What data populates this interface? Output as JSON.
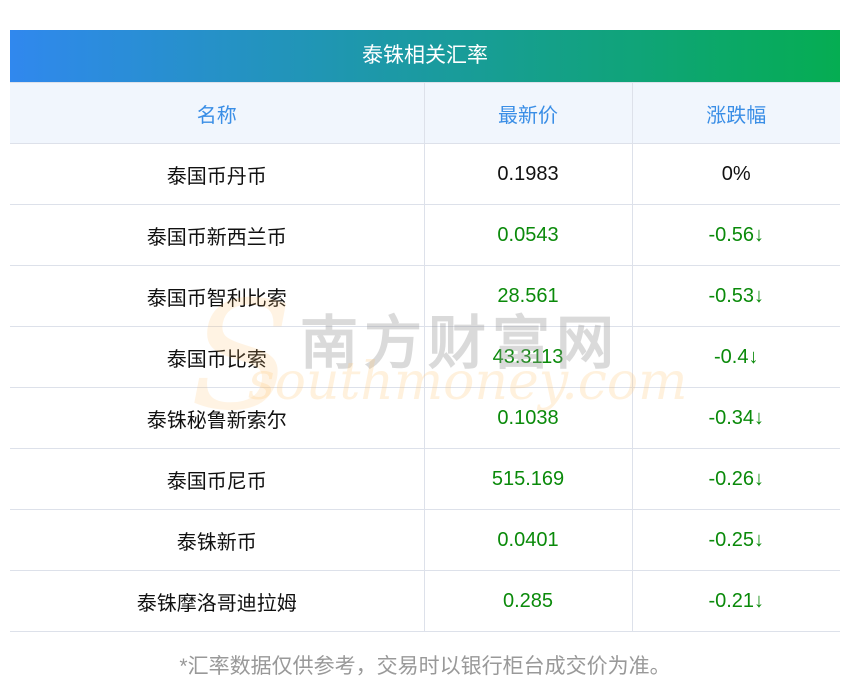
{
  "title": "泰铢相关汇率",
  "headers": [
    "名称",
    "最新价",
    "涨跌幅"
  ],
  "rows": [
    {
      "name": "泰国币丹币",
      "price": "0.1983",
      "change": "0%",
      "dir": "flat"
    },
    {
      "name": "泰国币新西兰币",
      "price": "0.0543",
      "change": "-0.56↓",
      "dir": "down"
    },
    {
      "name": "泰国币智利比索",
      "price": "28.561",
      "change": "-0.53↓",
      "dir": "down"
    },
    {
      "name": "泰国币比索",
      "price": "43.3113",
      "change": "-0.4↓",
      "dir": "down"
    },
    {
      "name": "泰铢秘鲁新索尔",
      "price": "0.1038",
      "change": "-0.34↓",
      "dir": "down"
    },
    {
      "name": "泰国币尼币",
      "price": "515.169",
      "change": "-0.26↓",
      "dir": "down"
    },
    {
      "name": "泰铢新币",
      "price": "0.0401",
      "change": "-0.25↓",
      "dir": "down"
    },
    {
      "name": "泰铢摩洛哥迪拉姆",
      "price": "0.285",
      "change": "-0.21↓",
      "dir": "down"
    }
  ],
  "footnote": "*汇率数据仅供参考，交易时以银行柜台成交价为准。",
  "watermark": {
    "cn": "南方财富网",
    "en": "southmoney.com"
  },
  "colors": {
    "down": "#0a8a0a",
    "header_text": "#3a8ee6"
  }
}
